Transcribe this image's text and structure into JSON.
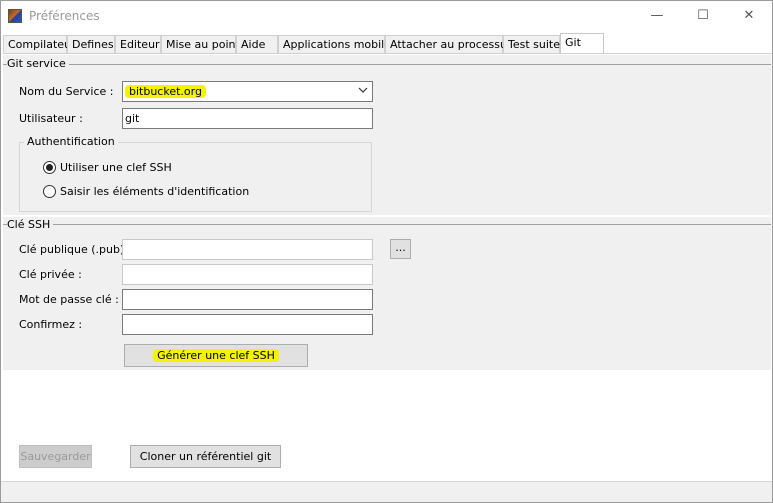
{
  "window": {
    "title": "Préférences",
    "minimize": "—",
    "maximize": "☐",
    "close": "✕"
  },
  "tabs": [
    {
      "label": "Compilateur"
    },
    {
      "label": "Defines"
    },
    {
      "label": "Editeur"
    },
    {
      "label": "Mise au point"
    },
    {
      "label": "Aide"
    },
    {
      "label": "Applications mobiles"
    },
    {
      "label": "Attacher au processus"
    },
    {
      "label": "Test suite"
    },
    {
      "label": "Git",
      "active": true
    }
  ],
  "git_service": {
    "section_title": "Git service",
    "service_label": "Nom du Service :",
    "service_value": "bitbucket.org",
    "user_label": "Utilisateur :",
    "user_value": "git",
    "auth": {
      "title": "Authentification",
      "option_ssh": "Utiliser une clef SSH",
      "option_credentials": "Saisir les éléments d'identification",
      "selected": "ssh"
    }
  },
  "ssh_key": {
    "section_title": "Clé SSH",
    "public_label": "Clé publique (.pub) :",
    "public_value": "",
    "browse_label": "...",
    "private_label": "Clé privée :",
    "private_value": "",
    "passphrase_label": "Mot de passe clé :",
    "passphrase_value": "",
    "confirm_label": "Confirmez :",
    "confirm_value": "",
    "generate_label": "Générer une clef SSH"
  },
  "footer": {
    "save_label": "Sauvegarder",
    "clone_label": "Cloner un référentiel git"
  },
  "colors": {
    "highlight": "#f3f300",
    "panel_grey": "#f0f0f0"
  }
}
